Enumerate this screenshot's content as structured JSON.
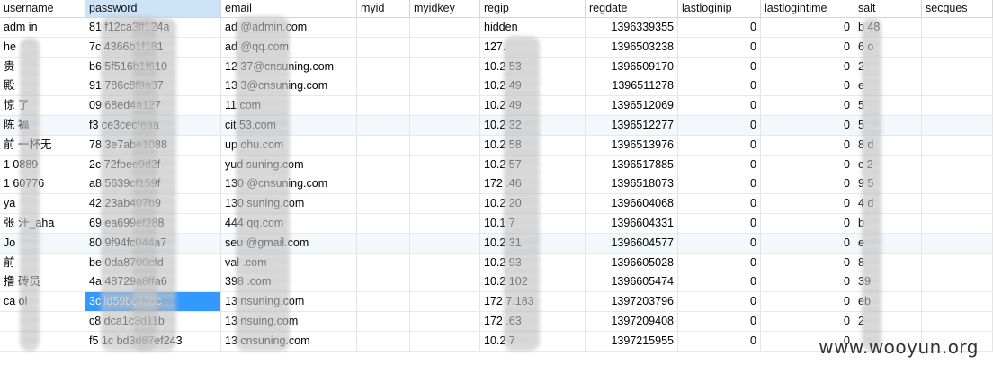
{
  "columns": [
    "username",
    "password",
    "email",
    "myid",
    "myidkey",
    "regip",
    "regdate",
    "lastloginip",
    "lastlogintime",
    "salt",
    "secques"
  ],
  "rows": [
    [
      "adm in",
      "81 f12ca3ff124a",
      "ad @admin.com",
      "",
      "",
      "hidden",
      "1396339355",
      "0",
      "0",
      "b 48",
      ""
    ],
    [
      "he",
      "7c 4366b1f181",
      "ad @qq.com",
      "",
      "",
      "127.",
      "1396503238",
      "0",
      "0",
      "6 o",
      ""
    ],
    [
      "贵 ",
      "b6 5f516b1f610",
      "12 37@cnsuning.com",
      "",
      "",
      "10.2 53",
      "1396509170",
      "0",
      "0",
      "2",
      ""
    ],
    [
      "殿",
      "91 786c8f9a37",
      "13 3@cnsuning.com",
      "",
      "",
      "10.2 49",
      "1396511278",
      "0",
      "0",
      "e",
      ""
    ],
    [
      "惊 了",
      "09 68ed4a127",
      "11 com",
      "",
      "",
      "10.2 49",
      "1396512069",
      "0",
      "0",
      "5",
      ""
    ],
    [
      "陈 福",
      "f3 ce3cecfeaa",
      "cit 53.com",
      "",
      "",
      "10.2 32",
      "1396512277",
      "0",
      "0",
      "5",
      ""
    ],
    [
      "前 一杯无",
      "78 3e7abe1088",
      "up ohu.com",
      "",
      "",
      "10.2 58",
      "1396513976",
      "0",
      "0",
      "8 d",
      ""
    ],
    [
      "1 0889",
      "2c 72fbee9d2f",
      "yud suning.com",
      "",
      "",
      "10.2 57",
      "1396517885",
      "0",
      "0",
      "c 2",
      ""
    ],
    [
      "1 60776",
      "a8 5639cf159f",
      "130 @cnsuning.com",
      "",
      "",
      "172 .46",
      "1396518073",
      "0",
      "0",
      "9 5",
      ""
    ],
    [
      "ya",
      "42 23ab407b9",
      "130 suning.com",
      "",
      "",
      "10.2 20",
      "1396604068",
      "0",
      "0",
      "4 d",
      ""
    ],
    [
      "张 汗_aha",
      "69 ea699ef288",
      "444 qq.com",
      "",
      "",
      "10.1 7",
      "1396604331",
      "0",
      "0",
      "b",
      ""
    ],
    [
      "Jo",
      "80 9f94fc044a7",
      "seu @gmail.com",
      "",
      "",
      "10.2 31",
      "1396604577",
      "0",
      "0",
      "e",
      ""
    ],
    [
      "前",
      "be 0da8700cfd",
      "val .com",
      "",
      "",
      "10.2 93",
      "1396605028",
      "0",
      "0",
      "8",
      ""
    ],
    [
      "撸 砖员",
      "4a 48729a8ffa6",
      "398 .com",
      "",
      "",
      "10.2 102",
      "1396605474",
      "0",
      "0",
      "39",
      ""
    ],
    [
      "ca ol",
      "3c id59bc43dc",
      "13 nsuning.com",
      "",
      "",
      "172 7.183",
      "1397203796",
      "0",
      "0",
      "eb",
      ""
    ],
    [
      "",
      "c8 dca1c3d11b",
      "13 nsuing.com",
      "",
      "",
      "172 .63",
      "1397209408",
      "0",
      "0",
      "2",
      ""
    ],
    [
      "",
      "f5 1c bd3d87ef243",
      "13 cnsuning.com",
      "",
      "",
      "10.2 7",
      "1397215955",
      "0",
      "0",
      "",
      ""
    ]
  ],
  "selected_row": 14,
  "selected_column": 1,
  "active_header": "password",
  "watermark": "www.wooyun.org"
}
